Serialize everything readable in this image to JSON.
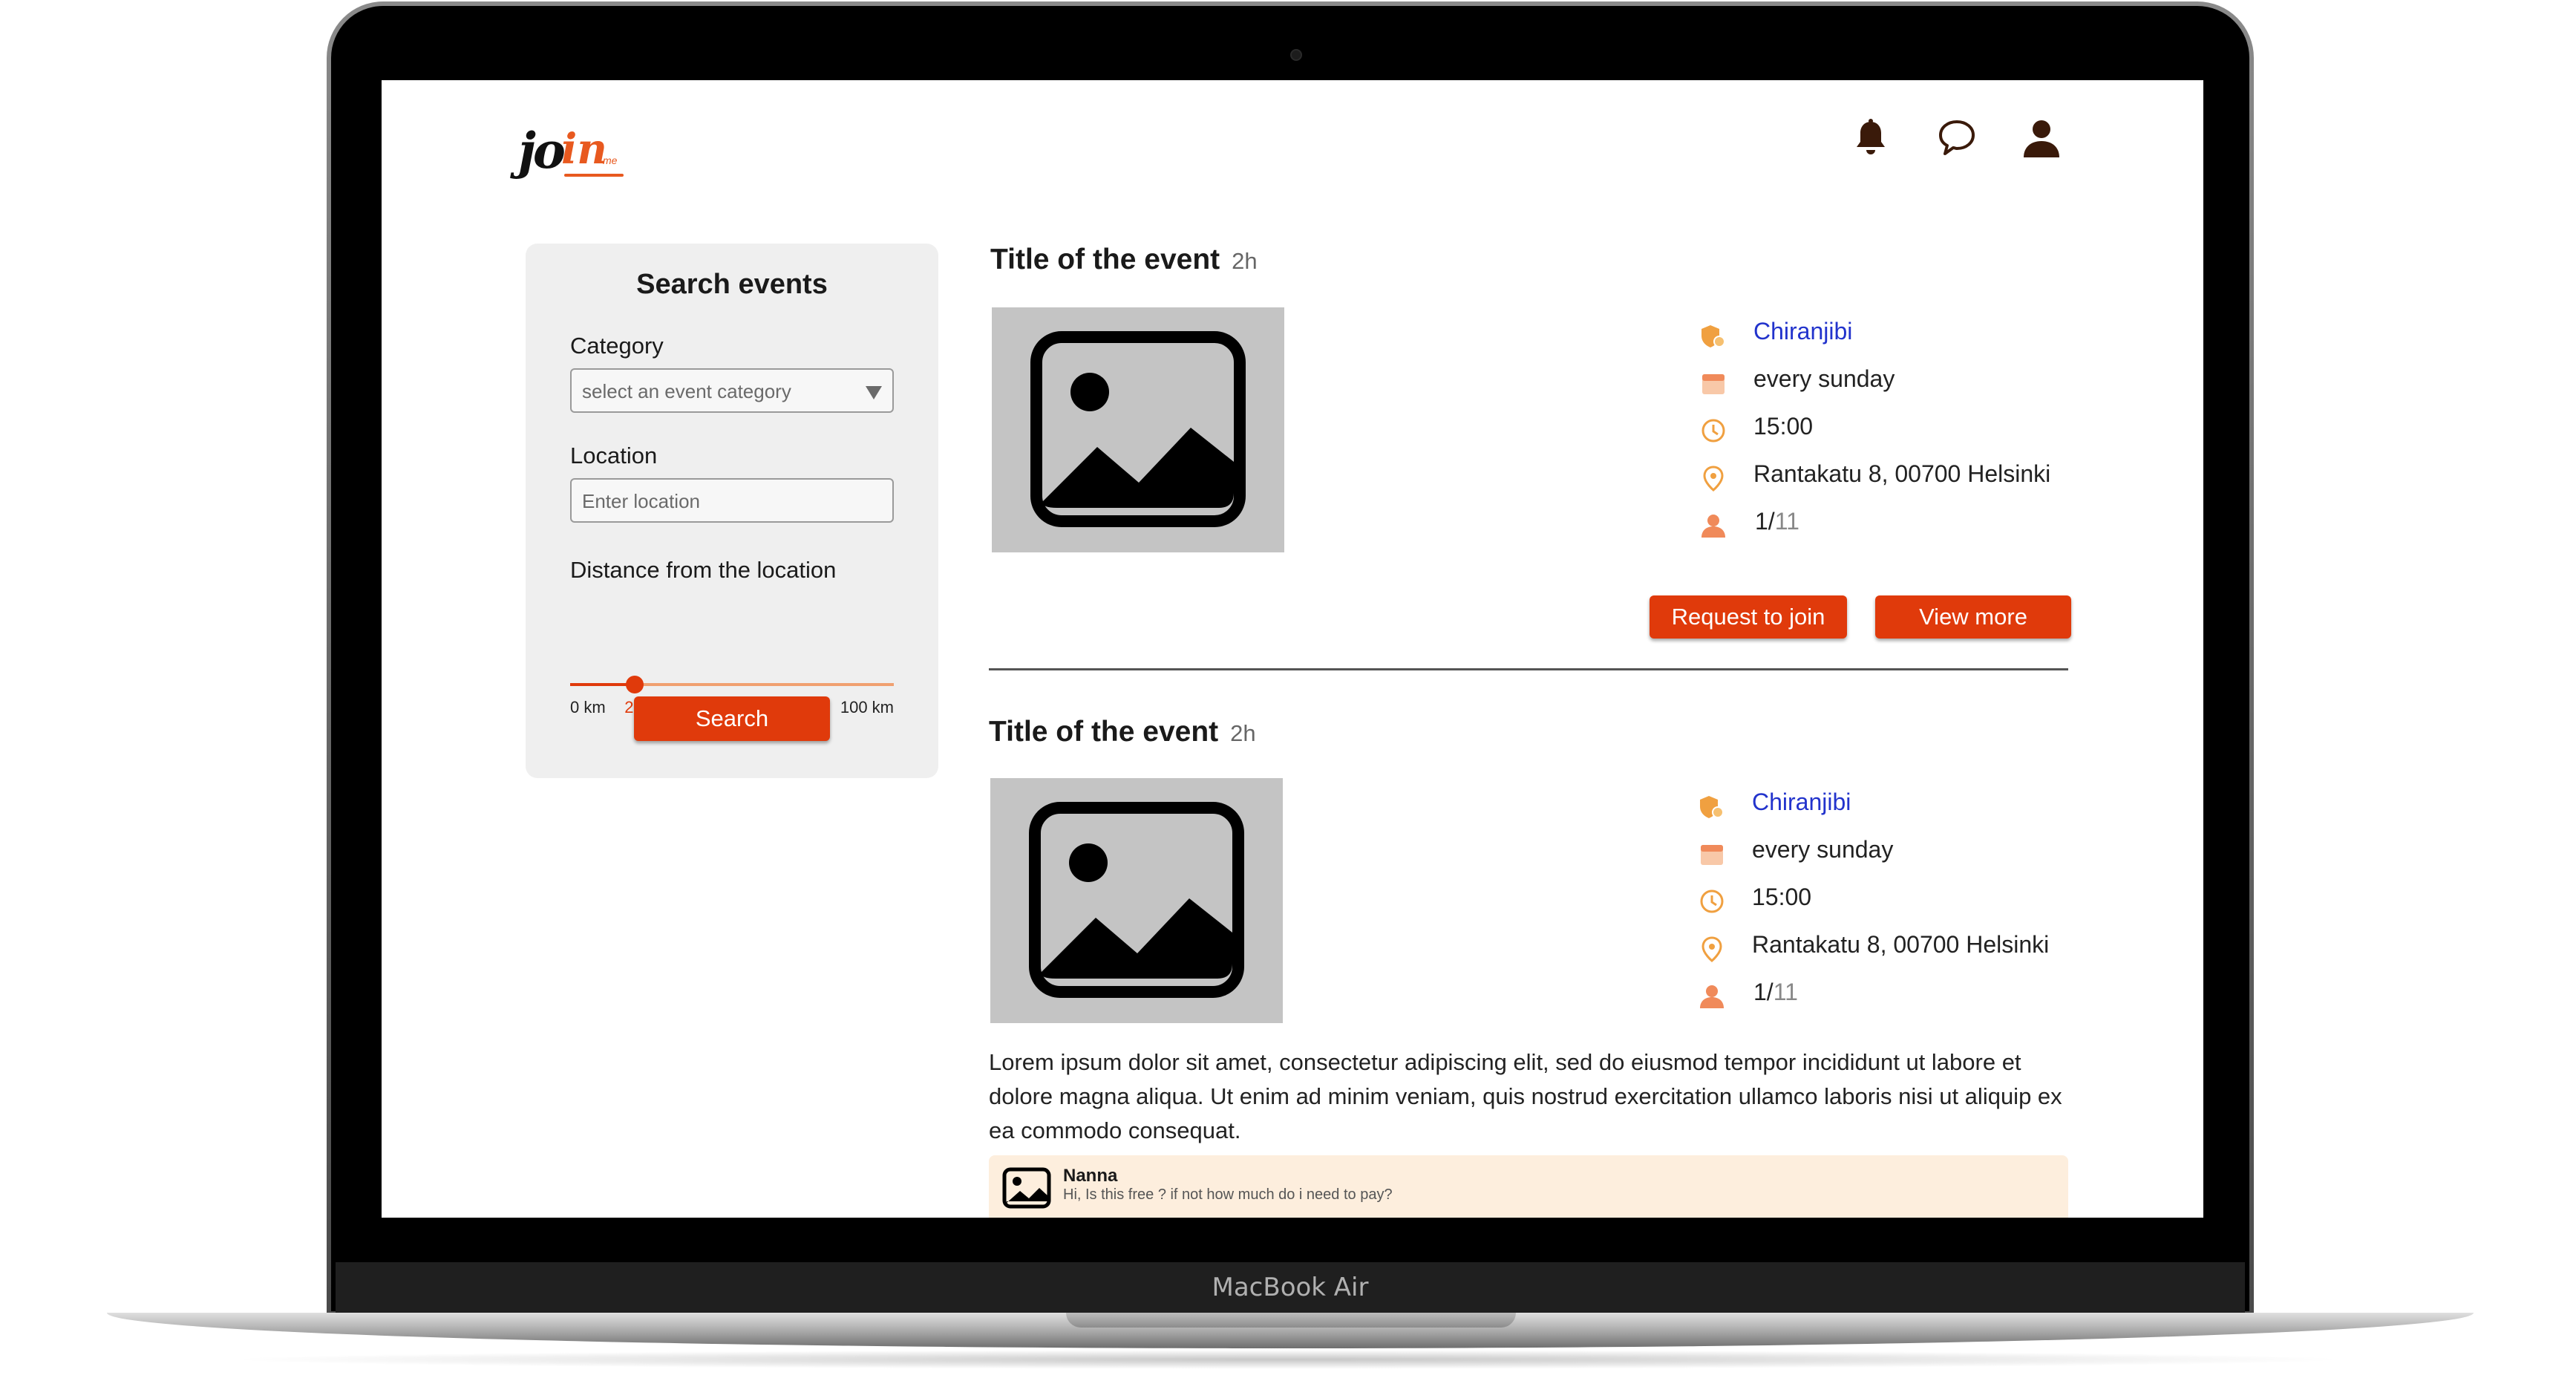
{
  "app": {
    "logo_main": "jo",
    "logo_accent": "in",
    "logo_suffix": "me"
  },
  "device": {
    "label": "MacBook Air"
  },
  "header": {
    "icons": [
      "bell-icon",
      "chat-bubble-icon",
      "user-icon"
    ]
  },
  "sidebar": {
    "title": "Search events",
    "category_label": "Category",
    "category_value": "select an event category",
    "location_label": "Location",
    "location_placeholder": "Enter location",
    "distance_label": "Distance from the location",
    "distance_min": "0 km",
    "distance_value": "20",
    "distance_max": "100 km",
    "distance_value_num": 20,
    "search_button": "Search"
  },
  "events": [
    {
      "title": "Title of the event",
      "time_ago": "2h",
      "organizer": "Chiranjibi",
      "recurrence": "every sunday",
      "time": "15:00",
      "address": "Rantakatu 8, 00700 Helsinki",
      "capacity_current": "1/",
      "capacity_total": "11",
      "request_button": "Request to join",
      "view_more_button": "View more"
    },
    {
      "title": "Title of the event",
      "time_ago": "2h",
      "organizer": "Chiranjibi",
      "recurrence": "every sunday",
      "time": "15:00",
      "address": "Rantakatu 8, 00700 Helsinki",
      "capacity_current": "1/",
      "capacity_total": "11",
      "description": "Lorem ipsum dolor sit amet, consectetur adipiscing elit, sed do eiusmod tempor incididunt ut labore et dolore magna aliqua. Ut enim ad minim veniam, quis nostrud exercitation ullamco laboris nisi ut aliquip ex ea commodo consequat.",
      "comment": {
        "author": "Nanna",
        "text": "Hi, Is this free ? if not how much do i need to pay?"
      }
    }
  ],
  "colors": {
    "accent": "#e03a0b",
    "icon_orange": "#f0a040",
    "link_blue": "#2233cc",
    "comment_bg": "#fdeedd"
  }
}
